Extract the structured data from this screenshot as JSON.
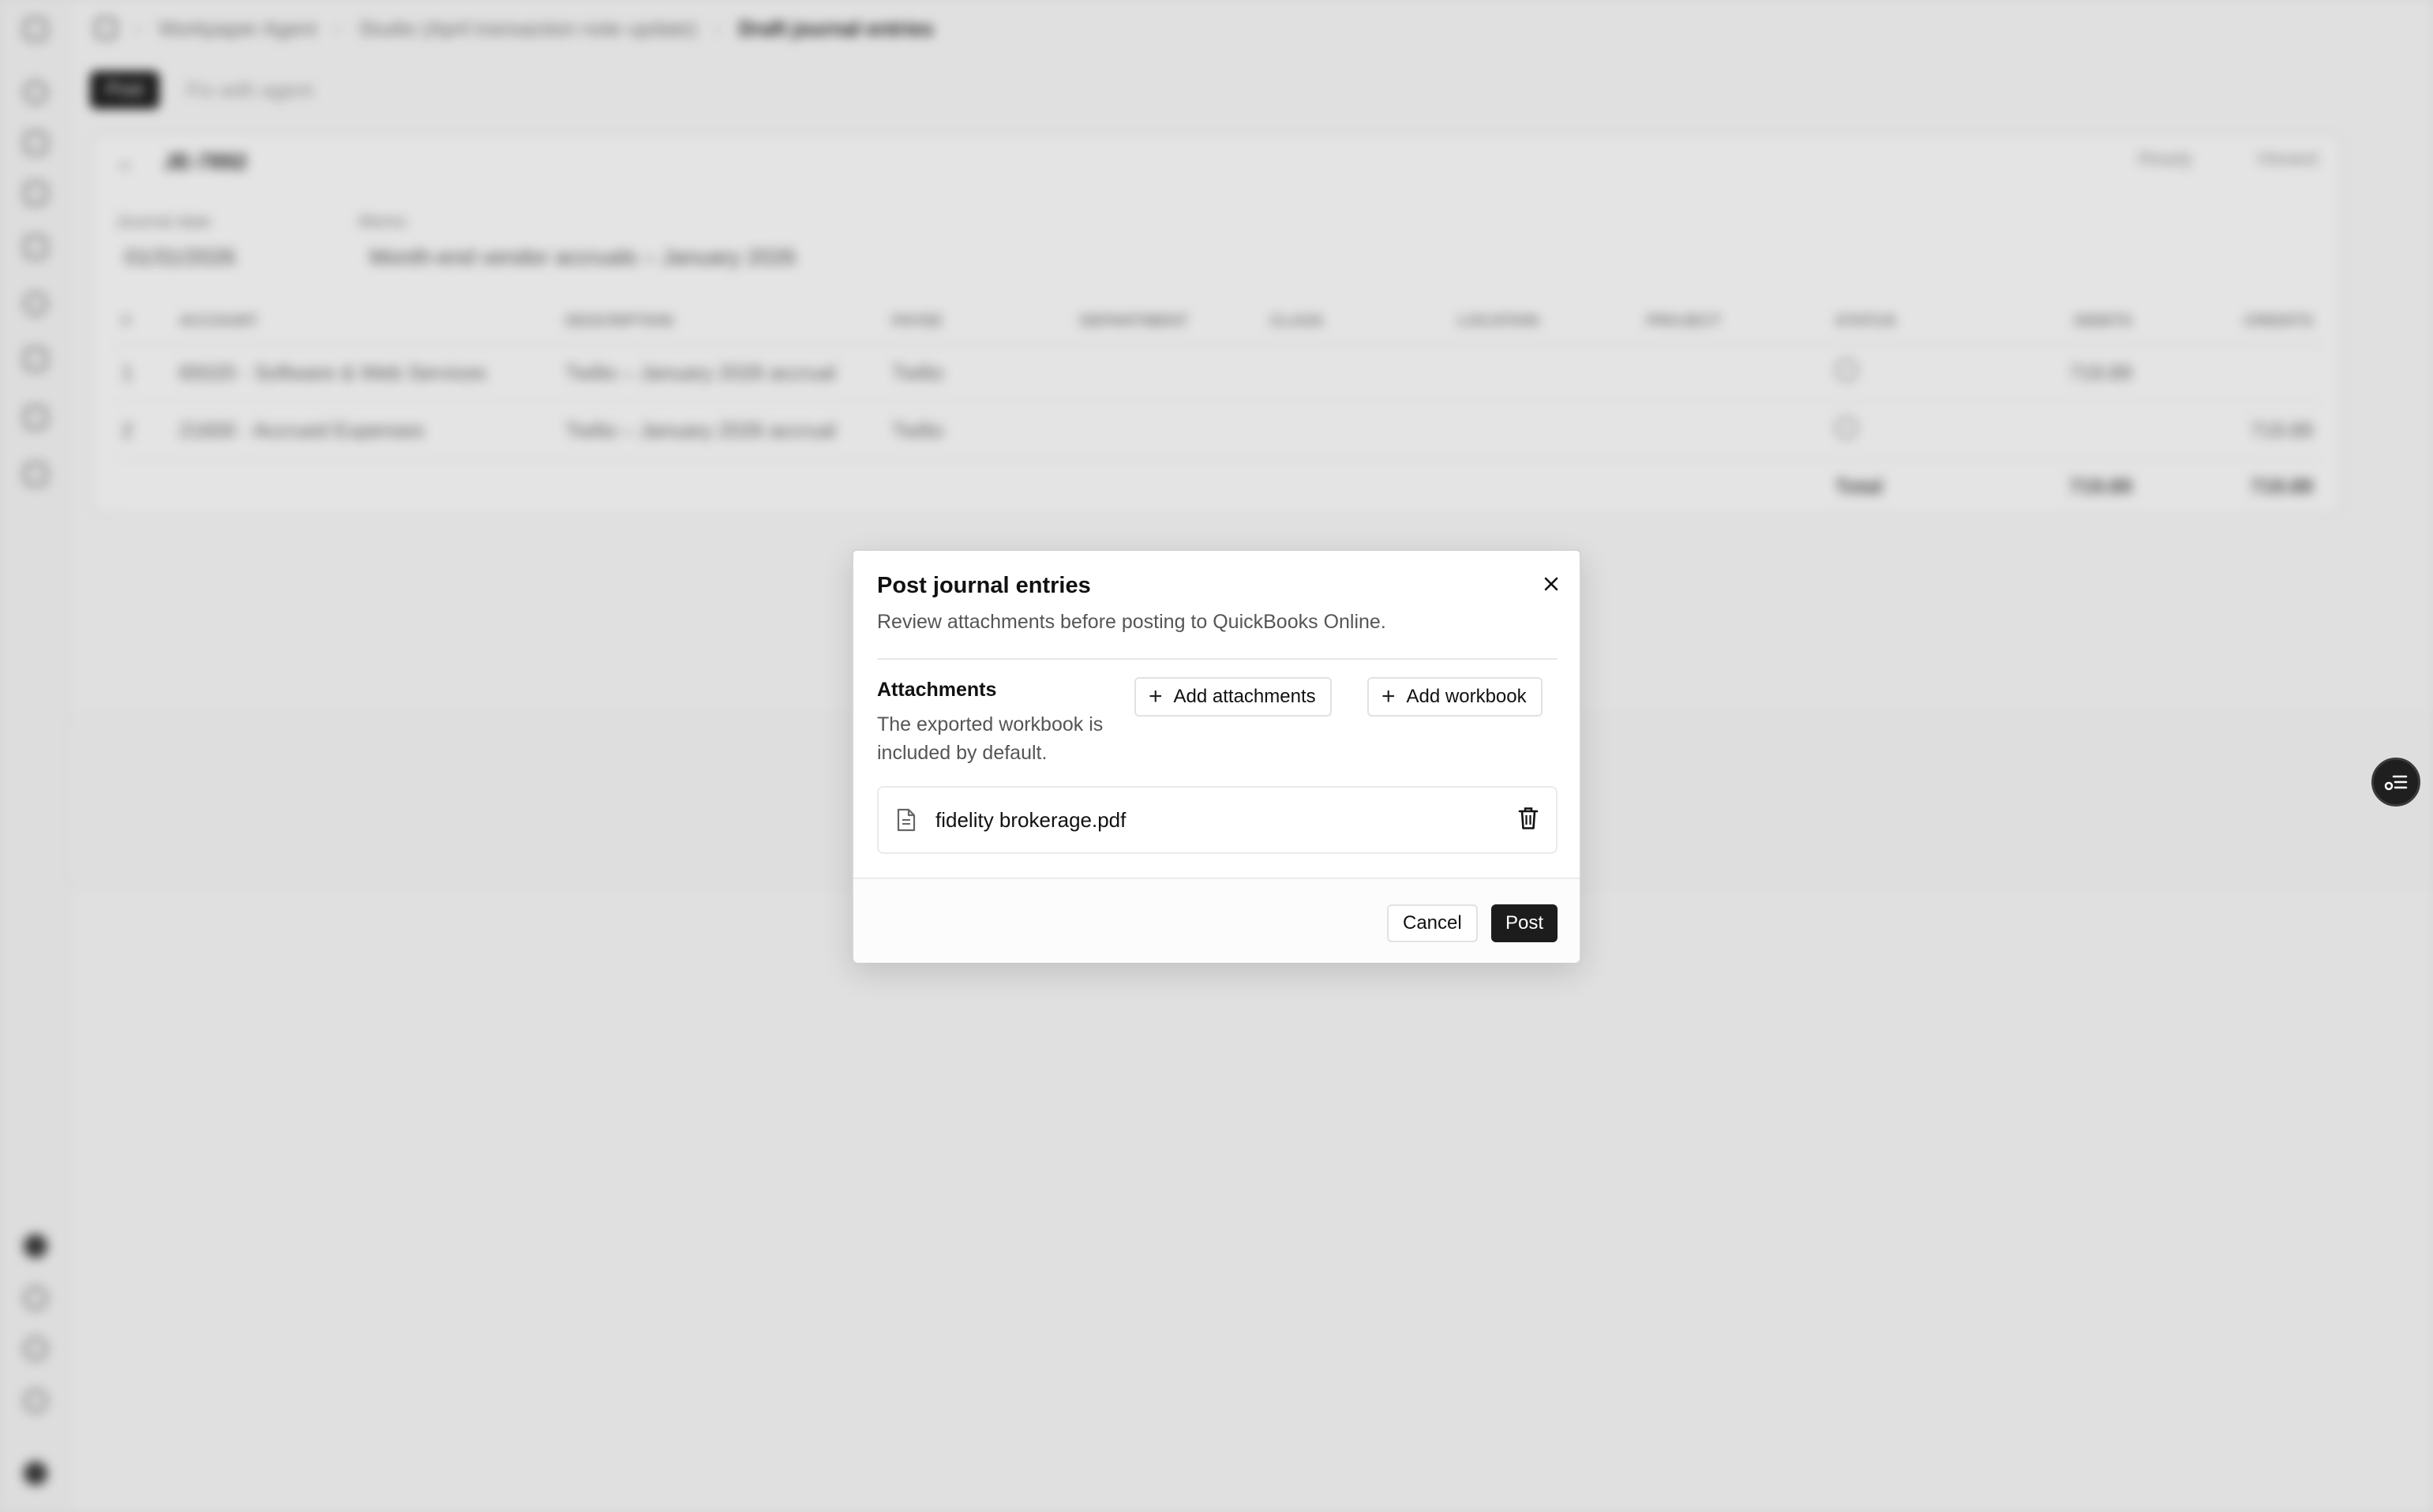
{
  "breadcrumb": {
    "items": [
      "Workpaper Agent",
      "Studio (April transaction note update)",
      "Draft journal entries"
    ]
  },
  "toolbar": {
    "post_label": "Post",
    "fix_label": "Fix with agent"
  },
  "journal": {
    "id": "JE-7892",
    "status_ready": "Ready",
    "status_viewed": "Viewed",
    "date_label": "Journal date",
    "date_value": "01/31/2026",
    "memo_label": "Memo",
    "memo_value": "Month-end vendor accruals – January 2026",
    "columns": [
      "#",
      "Account",
      "Description",
      "Payee",
      "Department",
      "Class",
      "Location",
      "Project",
      "Status",
      "Debits",
      "Credits"
    ],
    "rows": [
      {
        "n": "1",
        "account": "65020 · Software & Web Services",
        "description": "Twilio – January 2026 accrual",
        "payee": "Twilio",
        "debit": "719.89",
        "credit": ""
      },
      {
        "n": "2",
        "account": "21600 · Accrued Expenses",
        "description": "Twilio – January 2026 accrual",
        "payee": "Twilio",
        "debit": "",
        "credit": "719.89"
      }
    ],
    "total_label": "Total",
    "total_debit": "719.89",
    "total_credit": "719.89"
  },
  "modal": {
    "title": "Post journal entries",
    "subtitle": "Review attachments before posting to QuickBooks Online.",
    "attachments_title": "Attachments",
    "attachments_desc": "The exported workbook is included by default.",
    "add_attachments_label": "Add attachments",
    "add_workbook_label": "Add workbook",
    "file_name": "fidelity brokerage.pdf",
    "cancel_label": "Cancel",
    "post_label": "Post"
  },
  "icons": {
    "close": "close-icon",
    "plus": "plus-icon",
    "file": "file-icon",
    "trash": "trash-icon",
    "fab": "checklist-icon"
  },
  "colors": {
    "primary": "#1c1c1c",
    "backdrop": "#ebebeb"
  }
}
